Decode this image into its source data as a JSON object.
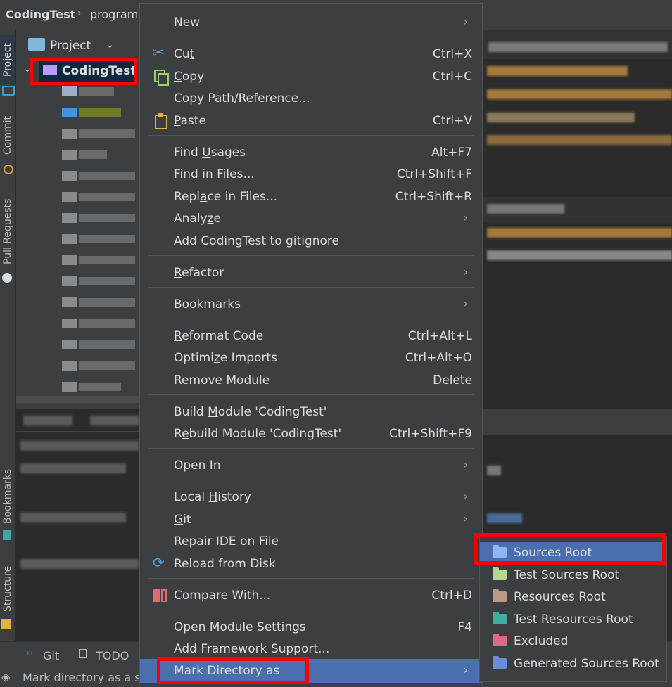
{
  "breadcrumb": {
    "project": "CodingTest",
    "folder": "program"
  },
  "tool_strip": {
    "project": "Project",
    "commit": "Commit",
    "pull_requests": "Pull Requests",
    "bookmarks": "Bookmarks",
    "structure": "Structure"
  },
  "project_panel": {
    "header": "Project",
    "root": "CodingTest"
  },
  "bottom_tabs": {
    "git": "Git",
    "todo": "TODO"
  },
  "status": {
    "text": "Mark directory as a s"
  },
  "context_menu": {
    "new": "New",
    "cut": {
      "pre": "Cu",
      "u": "t",
      "post": "",
      "shortcut": "Ctrl+X"
    },
    "copy": {
      "pre": "",
      "u": "C",
      "post": "opy",
      "shortcut": "Ctrl+C"
    },
    "copy_path": "Copy Path/Reference...",
    "paste": {
      "pre": "",
      "u": "P",
      "post": "aste",
      "shortcut": "Ctrl+V"
    },
    "find_usages": {
      "pre": "Find ",
      "u": "U",
      "post": "sages",
      "shortcut": "Alt+F7"
    },
    "find_in_files": {
      "label": "Find in Files...",
      "shortcut": "Ctrl+Shift+F"
    },
    "replace_in_files": {
      "pre": "Repl",
      "u": "a",
      "post": "ce in Files...",
      "shortcut": "Ctrl+Shift+R"
    },
    "analyze": {
      "pre": "Analy",
      "u": "z",
      "post": "e"
    },
    "add_gitignore": "Add CodingTest to gitignore",
    "refactor": {
      "pre": "",
      "u": "R",
      "post": "efactor"
    },
    "bookmarks": "Bookmarks",
    "reformat": {
      "pre": "",
      "u": "R",
      "post": "eformat Code",
      "shortcut": "Ctrl+Alt+L"
    },
    "optimize": {
      "pre": "Optimi",
      "u": "z",
      "post": "e Imports",
      "shortcut": "Ctrl+Alt+O"
    },
    "remove_module": {
      "label": "Remove Module",
      "shortcut": "Delete"
    },
    "build_module": {
      "pre": "Build ",
      "u": "M",
      "post": "odule 'CodingTest'"
    },
    "rebuild_module": {
      "pre": "R",
      "u": "e",
      "post": "build Module 'CodingTest'",
      "shortcut": "Ctrl+Shift+F9"
    },
    "open_in": "Open In",
    "local_history": {
      "pre": "Local ",
      "u": "H",
      "post": "istory"
    },
    "git": {
      "pre": "",
      "u": "G",
      "post": "it"
    },
    "repair_ide": "Repair IDE on File",
    "reload": "Reload from Disk",
    "compare_with": {
      "label": "Compare With...",
      "shortcut": "Ctrl+D"
    },
    "module_settings": {
      "label": "Open Module Settings",
      "shortcut": "F4"
    },
    "add_framework": "Add Framework Support...",
    "mark_directory": "Mark Directory as"
  },
  "submenu": {
    "sources_root": "Sources Root",
    "test_sources_root": "Test Sources Root",
    "resources_root": "Resources Root",
    "test_resources_root": "Test Resources Root",
    "excluded": "Excluded",
    "generated_sources_root": "Generated Sources Root"
  },
  "colors": {
    "menu_bg": "#3c3f41",
    "selection": "#4b6eaf",
    "highlight_box": "#ff0000",
    "ide_bg": "#2b2b2b"
  }
}
